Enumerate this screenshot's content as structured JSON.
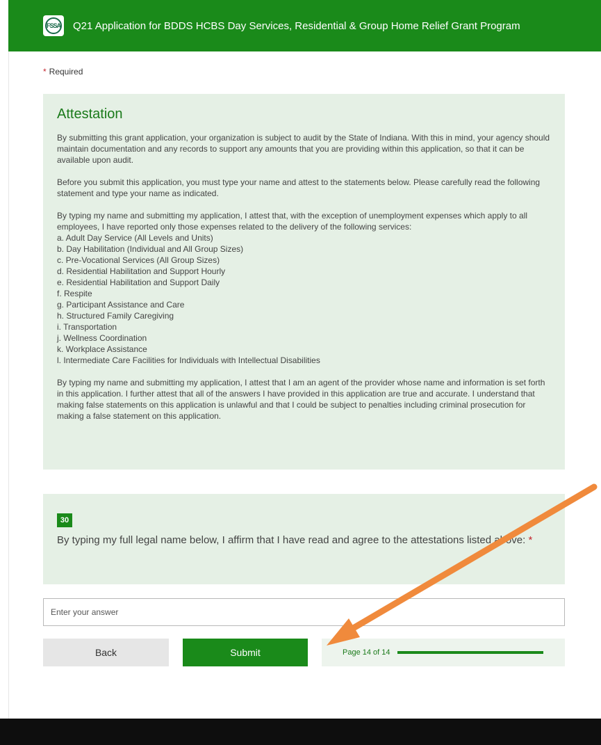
{
  "header": {
    "title": "Q21 Application for BDDS HCBS Day Services, Residential & Group Home Relief Grant Program",
    "logo_text": "FSSA"
  },
  "required_note": {
    "star": "*",
    "label": "Required"
  },
  "attestation": {
    "title": "Attestation",
    "para1": "By submitting this grant application, your organization is subject to audit by the State of Indiana. With this in mind, your agency should maintain documentation and any records to support any amounts that you are providing within this application, so that it can be available upon audit.",
    "para2": "Before you submit this application, you must type your name and attest to the statements below. Please carefully read the following statement and type your name as indicated.",
    "para3": "By typing my name and submitting my application, I attest that, with the exception of unemployment expenses which apply to all employees, I have reported only those expenses related to the delivery of the following services:",
    "services": [
      "a.  Adult Day Service (All Levels and Units)",
      "b.  Day Habilitation (Individual and All Group Sizes)",
      "c.  Pre-Vocational Services (All Group Sizes)",
      "d.  Residential Habilitation and Support Hourly",
      "e.  Residential Habilitation and Support Daily",
      "f.   Respite",
      "g.  Participant Assistance and Care",
      "h.  Structured Family Caregiving",
      "i.   Transportation",
      "j.   Wellness Coordination",
      "k.  Workplace Assistance",
      "l.   Intermediate Care Facilities for Individuals with Intellectual Disabilities"
    ],
    "para4": "By typing my name and submitting my application, I attest that I am an agent of the provider whose name and information is set forth in this application. I further attest that all of the answers I have provided in this application are true and accurate. I understand that making false statements on this application is unlawful and that I could be subject to penalties including criminal prosecution for making a false statement on this application."
  },
  "question": {
    "number": "30",
    "text": "By typing my full legal name below, I affirm that I have read and agree to the attestations listed above:",
    "required_star": "*"
  },
  "answer": {
    "placeholder": "Enter your answer",
    "value": ""
  },
  "nav": {
    "back_label": "Back",
    "submit_label": "Submit",
    "page_indicator": "Page 14 of 14",
    "progress_fraction": 1.0
  },
  "colors": {
    "header_green": "#1a8a1a",
    "panel_bg": "#e5f0e5",
    "required_red": "#c4262e",
    "annotation_arrow": "#f08a3c"
  }
}
